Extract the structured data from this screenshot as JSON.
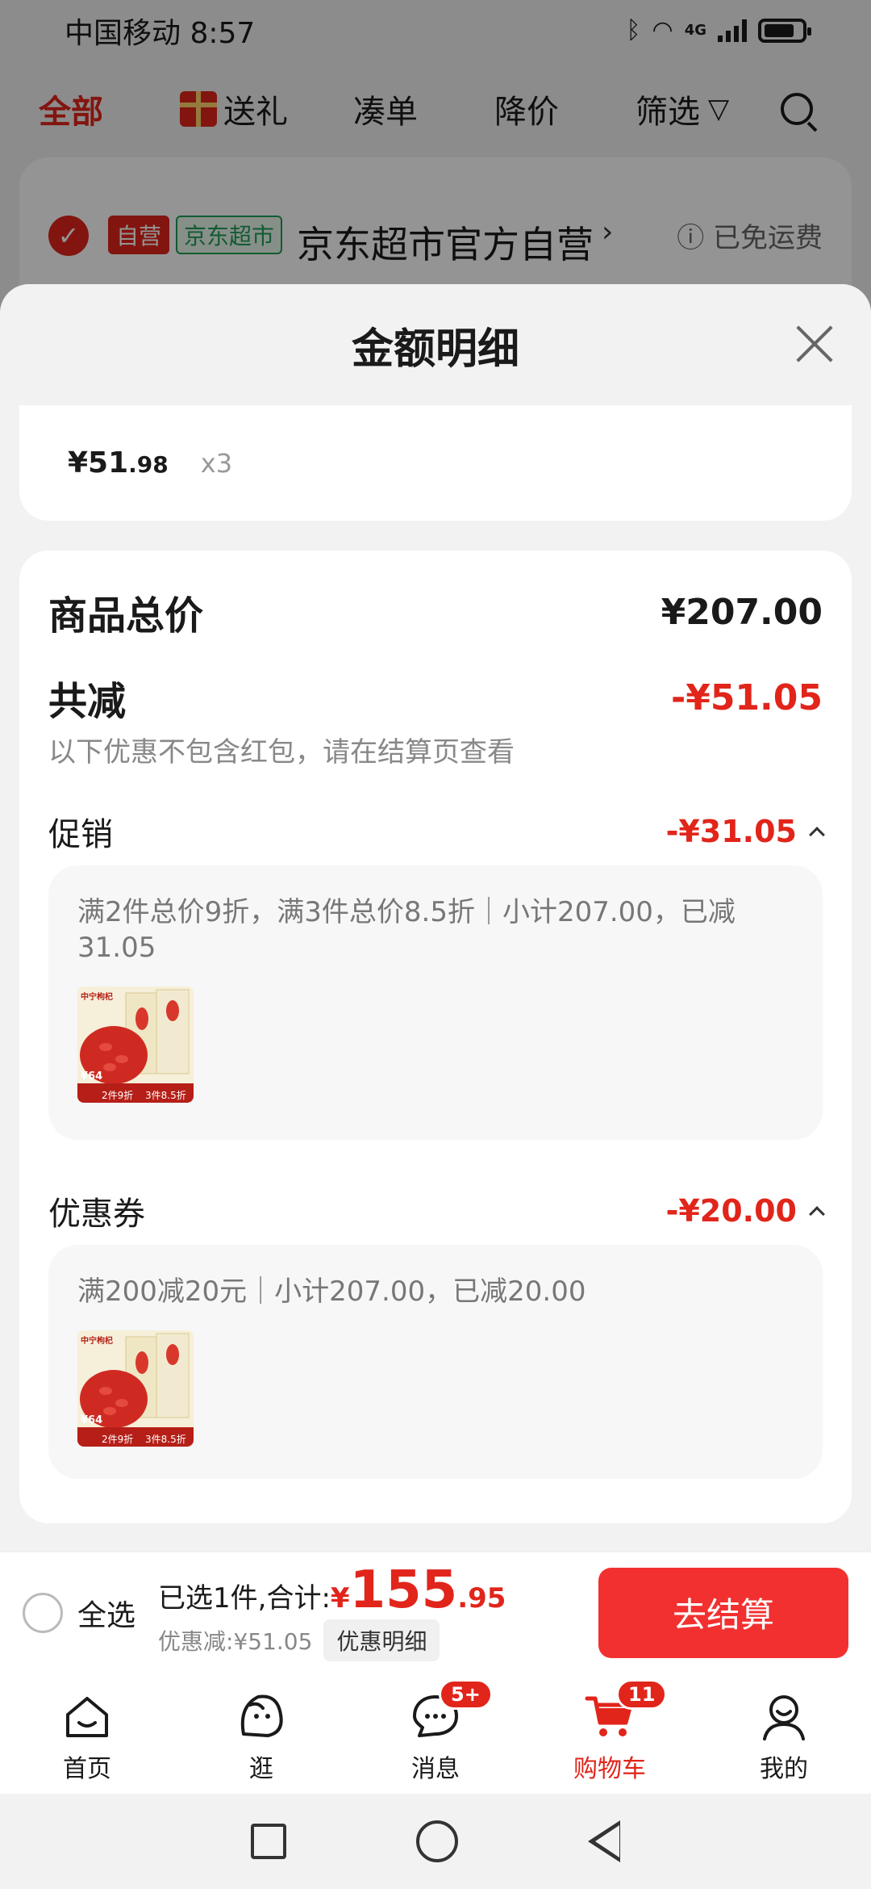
{
  "status_bar": {
    "carrier": "中国移动",
    "time": "8:57",
    "network": "4G"
  },
  "top_tabs": {
    "all": "全部",
    "gift": "送礼",
    "cou": "凑单",
    "price_drop": "降价",
    "filter": "筛选"
  },
  "shop": {
    "self_badge": "自营",
    "jd_badge": "京东超市",
    "name": "京东超市官方自营",
    "arrow": "›",
    "shipping": "ⓘ 已免运费"
  },
  "sheet": {
    "title": "金额明细",
    "item": {
      "price_yen": "¥51",
      "price_cents": ".98",
      "qty": "x3"
    },
    "total_label": "商品总价",
    "total_value": "¥207.00",
    "discount_label": "共减",
    "discount_value": "-¥51.05",
    "discount_note": "以下优惠不包含红包，请在结算页查看",
    "promo": {
      "label": "促销",
      "value": "-¥31.05",
      "text": "满2件总价9折，满3件总价8.5折｜小计207.00，已减31.05"
    },
    "coupon": {
      "label": "优惠券",
      "value": "-¥20.00",
      "text": "满200减20元｜小计207.00，已减20.00"
    },
    "thumb": {
      "brand": "中宁枸杞",
      "tag1": "2件9折",
      "tag2": "3件8.5折",
      "price": "¥64"
    }
  },
  "checkout": {
    "select_all": "全选",
    "summary_prefix": "已选1件,合计:",
    "total_yen": "¥",
    "total_int": "155",
    "total_dec": ".95",
    "discount_text": "优惠减:¥51.05",
    "detail_chip": "优惠明细",
    "button": "去结算"
  },
  "tabbar": {
    "items": [
      {
        "label": "首页",
        "icon": "home-icon"
      },
      {
        "label": "逛",
        "icon": "explore-icon"
      },
      {
        "label": "消息",
        "icon": "message-icon",
        "badge": "5+"
      },
      {
        "label": "购物车",
        "icon": "cart-icon",
        "badge": "11"
      },
      {
        "label": "我的",
        "icon": "profile-icon"
      }
    ]
  },
  "colors": {
    "accent": "#e1251b",
    "checkout_button": "#f23030"
  }
}
